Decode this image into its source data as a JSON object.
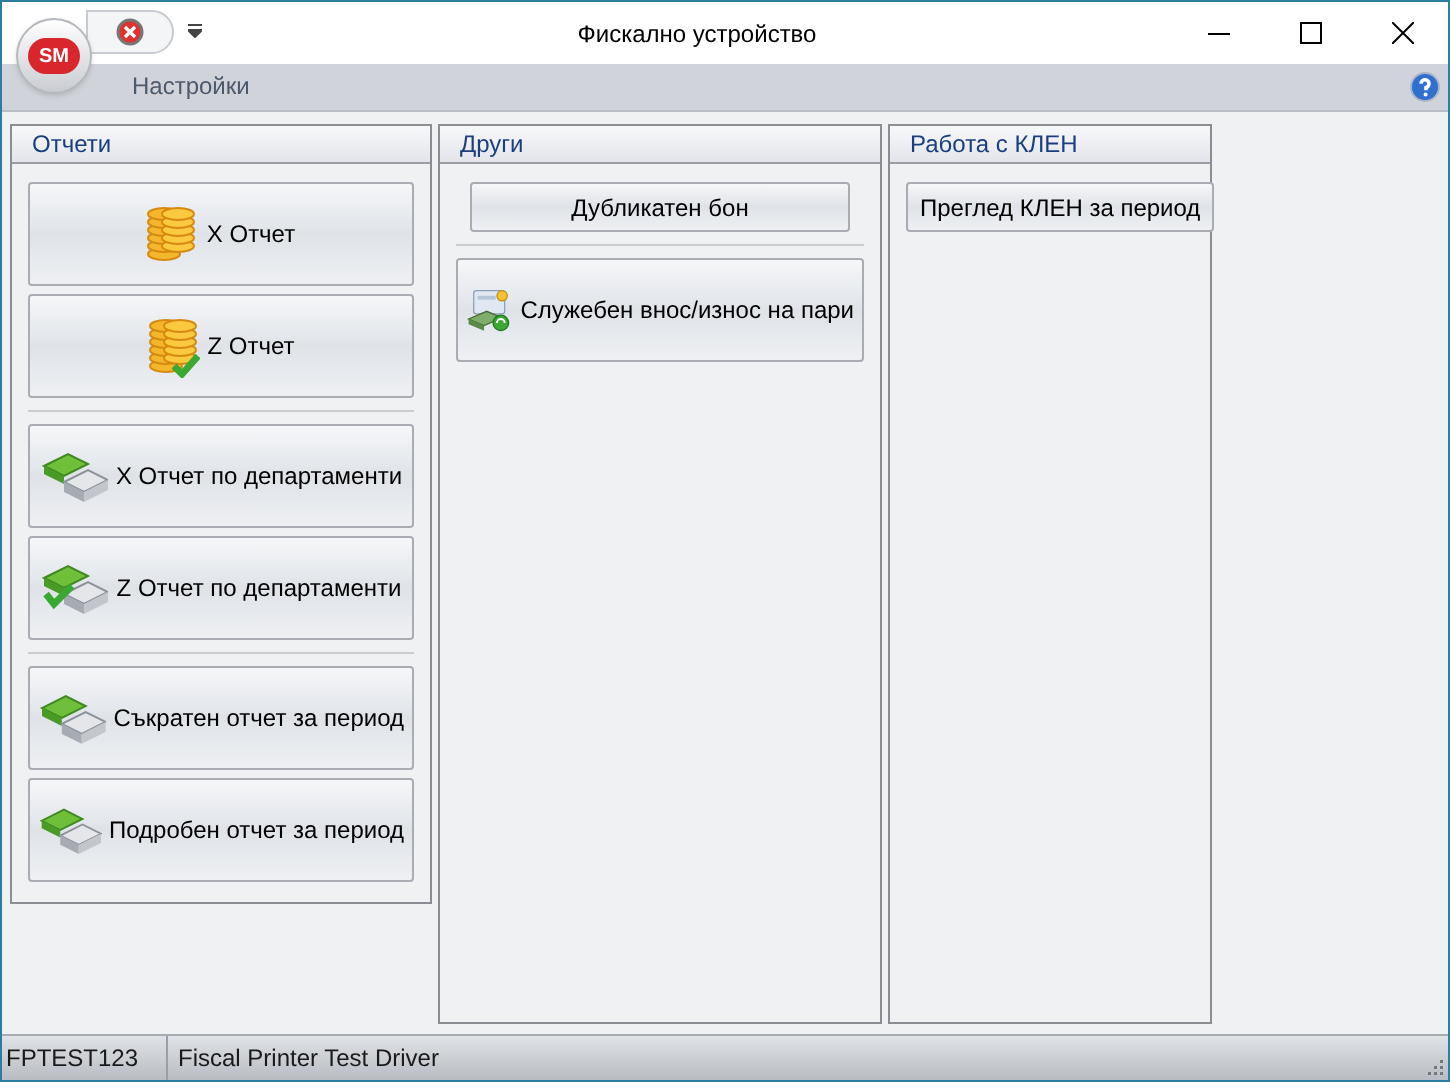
{
  "window": {
    "title": "Фискално устройство",
    "logo_text": "SM"
  },
  "ribbon_tabs": [
    {
      "label": "Настройки",
      "selected": false
    }
  ],
  "panels": [
    {
      "title": "Отчети",
      "groups": [
        [
          {
            "label": "X Отчет",
            "kind": "coins"
          },
          {
            "label": "Z Отчет",
            "kind": "coins-check"
          }
        ],
        [
          {
            "label": "X Отчет по департаменти",
            "kind": "cash"
          },
          {
            "label": "Z Отчет по департаменти",
            "kind": "cash-check"
          }
        ],
        [
          {
            "label": "Съкратен отчет за период",
            "kind": "cash"
          },
          {
            "label": "Подробен отчет за период",
            "kind": "cash"
          }
        ]
      ]
    },
    {
      "title": "Други",
      "groups": [
        [
          {
            "label": "Дубликатен бон",
            "kind": "plain"
          }
        ],
        [
          {
            "label": "Служебен внос/износ на пари",
            "kind": "transfer"
          }
        ]
      ]
    },
    {
      "title": "Работа с КЛЕН",
      "groups": [
        [
          {
            "label": "Преглед КЛЕН за период",
            "kind": "plain"
          }
        ]
      ]
    }
  ],
  "status_bar": [
    "FPTEST123",
    "Fiscal Printer Test Driver"
  ]
}
